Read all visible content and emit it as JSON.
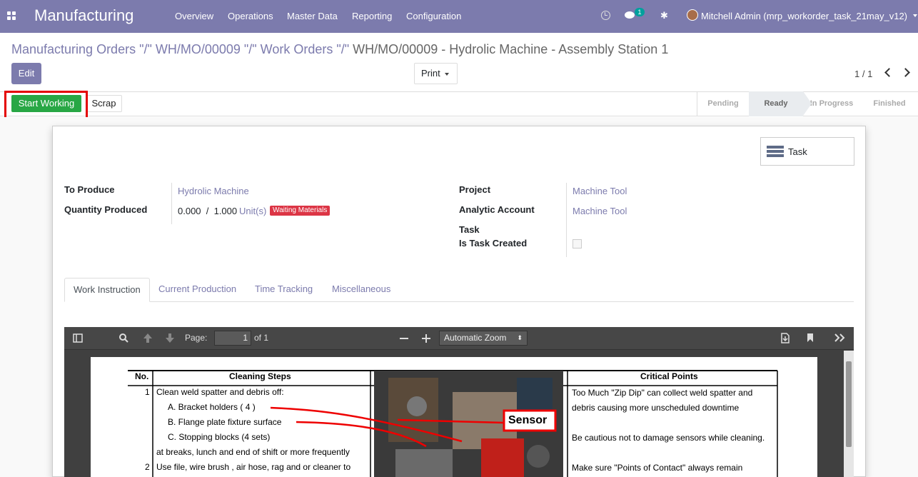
{
  "navbar": {
    "brand": "Manufacturing",
    "menu": [
      "Overview",
      "Operations",
      "Master Data",
      "Reporting",
      "Configuration"
    ],
    "chat_count": "1",
    "user": "Mitchell Admin (mrp_workorder_task_21may_v12)"
  },
  "breadcrumb": {
    "part1": "Manufacturing Orders \"/\" WH/MO/00009 \"/\" Work Orders \"/\"",
    "current": "WH/MO/00009 - Hydrolic Machine - Assembly Station 1"
  },
  "control": {
    "edit_label": "Edit",
    "print_label": "Print",
    "pager": "1 / 1"
  },
  "statusbar": {
    "start_label": "Start Working",
    "scrap_label": "Scrap",
    "stages": [
      "Pending",
      "Ready",
      "In Progress",
      "Finished"
    ],
    "active_stage": "Ready"
  },
  "form": {
    "task_button": "Task",
    "to_produce_label": "To Produce",
    "to_produce_value": "Hydrolic Machine",
    "qty_label": "Quantity Produced",
    "qty_value": "0.000  /  1.000",
    "qty_unit": "Unit(s)",
    "qty_badge": "Waiting Materials",
    "project_label": "Project",
    "project_value": "Machine Tool",
    "analytic_label": "Analytic Account",
    "analytic_value": "Machine Tool",
    "task_label": "Task",
    "is_task_label": "Is Task Created"
  },
  "tabs": [
    "Work Instruction",
    "Current Production",
    "Time Tracking",
    "Miscellaneous"
  ],
  "pdf": {
    "page_label": "Page:",
    "page_value": "1",
    "page_of": "of 1",
    "zoom": "Automatic Zoom",
    "col_no": "No.",
    "col_steps": "Cleaning Steps",
    "col_critical": "Critical Points",
    "rows": [
      {
        "no": "1",
        "text": "Clean weld spatter and debris off:"
      },
      {
        "no": "",
        "text": "A. Bracket holders ( 4 )"
      },
      {
        "no": "",
        "text": "B. Flange plate fixture surface"
      },
      {
        "no": "",
        "text": "C. Stopping blocks (4 sets)"
      },
      {
        "no": "",
        "text": "at breaks, lunch and end of shift or more frequently"
      },
      {
        "no": "2",
        "text": "Use file, wire brush , air hose, rag and or cleaner to"
      }
    ],
    "critical": [
      "Too Much \"Zip Dip\" can collect weld spatter and",
      "debris causing more unscheduled downtime",
      "Be cautious not to damage sensors while cleaning.",
      "Make sure \"Points of Contact\" always remain"
    ],
    "sensor_label": "Sensor"
  }
}
